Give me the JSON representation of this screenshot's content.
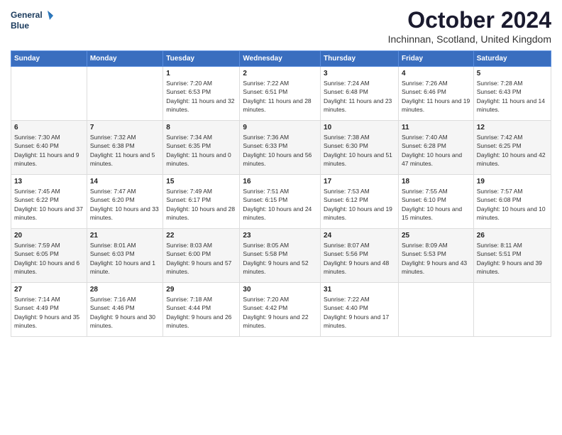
{
  "logo": {
    "line1": "General",
    "line2": "Blue"
  },
  "title": "October 2024",
  "subtitle": "Inchinnan, Scotland, United Kingdom",
  "header_row": [
    "Sunday",
    "Monday",
    "Tuesday",
    "Wednesday",
    "Thursday",
    "Friday",
    "Saturday"
  ],
  "weeks": [
    [
      {
        "num": "",
        "sunrise": "",
        "sunset": "",
        "daylight": ""
      },
      {
        "num": "",
        "sunrise": "",
        "sunset": "",
        "daylight": ""
      },
      {
        "num": "1",
        "sunrise": "Sunrise: 7:20 AM",
        "sunset": "Sunset: 6:53 PM",
        "daylight": "Daylight: 11 hours and 32 minutes."
      },
      {
        "num": "2",
        "sunrise": "Sunrise: 7:22 AM",
        "sunset": "Sunset: 6:51 PM",
        "daylight": "Daylight: 11 hours and 28 minutes."
      },
      {
        "num": "3",
        "sunrise": "Sunrise: 7:24 AM",
        "sunset": "Sunset: 6:48 PM",
        "daylight": "Daylight: 11 hours and 23 minutes."
      },
      {
        "num": "4",
        "sunrise": "Sunrise: 7:26 AM",
        "sunset": "Sunset: 6:46 PM",
        "daylight": "Daylight: 11 hours and 19 minutes."
      },
      {
        "num": "5",
        "sunrise": "Sunrise: 7:28 AM",
        "sunset": "Sunset: 6:43 PM",
        "daylight": "Daylight: 11 hours and 14 minutes."
      }
    ],
    [
      {
        "num": "6",
        "sunrise": "Sunrise: 7:30 AM",
        "sunset": "Sunset: 6:40 PM",
        "daylight": "Daylight: 11 hours and 9 minutes."
      },
      {
        "num": "7",
        "sunrise": "Sunrise: 7:32 AM",
        "sunset": "Sunset: 6:38 PM",
        "daylight": "Daylight: 11 hours and 5 minutes."
      },
      {
        "num": "8",
        "sunrise": "Sunrise: 7:34 AM",
        "sunset": "Sunset: 6:35 PM",
        "daylight": "Daylight: 11 hours and 0 minutes."
      },
      {
        "num": "9",
        "sunrise": "Sunrise: 7:36 AM",
        "sunset": "Sunset: 6:33 PM",
        "daylight": "Daylight: 10 hours and 56 minutes."
      },
      {
        "num": "10",
        "sunrise": "Sunrise: 7:38 AM",
        "sunset": "Sunset: 6:30 PM",
        "daylight": "Daylight: 10 hours and 51 minutes."
      },
      {
        "num": "11",
        "sunrise": "Sunrise: 7:40 AM",
        "sunset": "Sunset: 6:28 PM",
        "daylight": "Daylight: 10 hours and 47 minutes."
      },
      {
        "num": "12",
        "sunrise": "Sunrise: 7:42 AM",
        "sunset": "Sunset: 6:25 PM",
        "daylight": "Daylight: 10 hours and 42 minutes."
      }
    ],
    [
      {
        "num": "13",
        "sunrise": "Sunrise: 7:45 AM",
        "sunset": "Sunset: 6:22 PM",
        "daylight": "Daylight: 10 hours and 37 minutes."
      },
      {
        "num": "14",
        "sunrise": "Sunrise: 7:47 AM",
        "sunset": "Sunset: 6:20 PM",
        "daylight": "Daylight: 10 hours and 33 minutes."
      },
      {
        "num": "15",
        "sunrise": "Sunrise: 7:49 AM",
        "sunset": "Sunset: 6:17 PM",
        "daylight": "Daylight: 10 hours and 28 minutes."
      },
      {
        "num": "16",
        "sunrise": "Sunrise: 7:51 AM",
        "sunset": "Sunset: 6:15 PM",
        "daylight": "Daylight: 10 hours and 24 minutes."
      },
      {
        "num": "17",
        "sunrise": "Sunrise: 7:53 AM",
        "sunset": "Sunset: 6:12 PM",
        "daylight": "Daylight: 10 hours and 19 minutes."
      },
      {
        "num": "18",
        "sunrise": "Sunrise: 7:55 AM",
        "sunset": "Sunset: 6:10 PM",
        "daylight": "Daylight: 10 hours and 15 minutes."
      },
      {
        "num": "19",
        "sunrise": "Sunrise: 7:57 AM",
        "sunset": "Sunset: 6:08 PM",
        "daylight": "Daylight: 10 hours and 10 minutes."
      }
    ],
    [
      {
        "num": "20",
        "sunrise": "Sunrise: 7:59 AM",
        "sunset": "Sunset: 6:05 PM",
        "daylight": "Daylight: 10 hours and 6 minutes."
      },
      {
        "num": "21",
        "sunrise": "Sunrise: 8:01 AM",
        "sunset": "Sunset: 6:03 PM",
        "daylight": "Daylight: 10 hours and 1 minute."
      },
      {
        "num": "22",
        "sunrise": "Sunrise: 8:03 AM",
        "sunset": "Sunset: 6:00 PM",
        "daylight": "Daylight: 9 hours and 57 minutes."
      },
      {
        "num": "23",
        "sunrise": "Sunrise: 8:05 AM",
        "sunset": "Sunset: 5:58 PM",
        "daylight": "Daylight: 9 hours and 52 minutes."
      },
      {
        "num": "24",
        "sunrise": "Sunrise: 8:07 AM",
        "sunset": "Sunset: 5:56 PM",
        "daylight": "Daylight: 9 hours and 48 minutes."
      },
      {
        "num": "25",
        "sunrise": "Sunrise: 8:09 AM",
        "sunset": "Sunset: 5:53 PM",
        "daylight": "Daylight: 9 hours and 43 minutes."
      },
      {
        "num": "26",
        "sunrise": "Sunrise: 8:11 AM",
        "sunset": "Sunset: 5:51 PM",
        "daylight": "Daylight: 9 hours and 39 minutes."
      }
    ],
    [
      {
        "num": "27",
        "sunrise": "Sunrise: 7:14 AM",
        "sunset": "Sunset: 4:49 PM",
        "daylight": "Daylight: 9 hours and 35 minutes."
      },
      {
        "num": "28",
        "sunrise": "Sunrise: 7:16 AM",
        "sunset": "Sunset: 4:46 PM",
        "daylight": "Daylight: 9 hours and 30 minutes."
      },
      {
        "num": "29",
        "sunrise": "Sunrise: 7:18 AM",
        "sunset": "Sunset: 4:44 PM",
        "daylight": "Daylight: 9 hours and 26 minutes."
      },
      {
        "num": "30",
        "sunrise": "Sunrise: 7:20 AM",
        "sunset": "Sunset: 4:42 PM",
        "daylight": "Daylight: 9 hours and 22 minutes."
      },
      {
        "num": "31",
        "sunrise": "Sunrise: 7:22 AM",
        "sunset": "Sunset: 4:40 PM",
        "daylight": "Daylight: 9 hours and 17 minutes."
      },
      {
        "num": "",
        "sunrise": "",
        "sunset": "",
        "daylight": ""
      },
      {
        "num": "",
        "sunrise": "",
        "sunset": "",
        "daylight": ""
      }
    ]
  ],
  "colors": {
    "header_bg": "#3a6ebf",
    "header_text": "#ffffff",
    "row_odd": "#ffffff",
    "row_even": "#f5f5f5"
  }
}
